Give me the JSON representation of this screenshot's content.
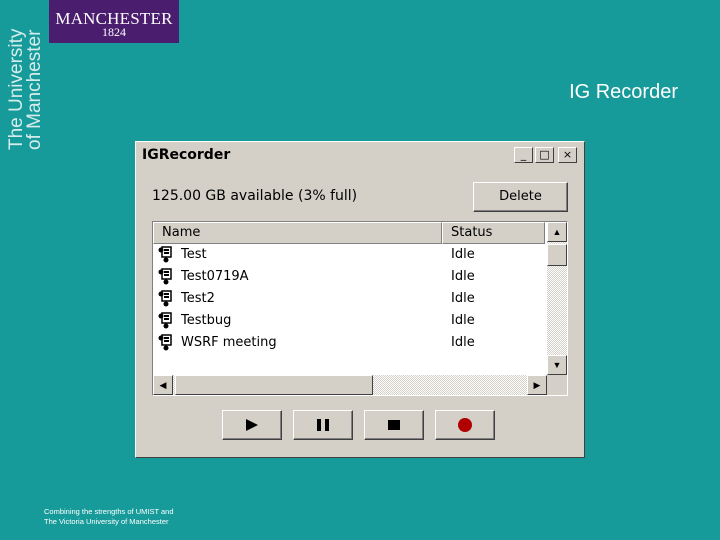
{
  "branding": {
    "logo_word": "MANCHESTER",
    "logo_year": "1824",
    "vertical_line1": "The University",
    "vertical_line2": "of Manchester",
    "colors": {
      "logo_bg": "#4b1d6e",
      "slide_bg": "#179b9a"
    }
  },
  "slide": {
    "title": "IG Recorder",
    "footer_line1": "Combining the strengths of UMIST and",
    "footer_line2": "The Victoria University of Manchester"
  },
  "window": {
    "title": "IGRecorder",
    "controls": {
      "minimize": "_",
      "maximize": "□",
      "close": "×"
    },
    "storage_text": "125.00 GB  available (3% full)",
    "delete_label": "Delete",
    "columns": {
      "name": "Name",
      "status": "Status"
    },
    "recordings": [
      {
        "name": "Test",
        "status": "Idle",
        "icon": "recording-icon"
      },
      {
        "name": "Test0719A",
        "status": "Idle",
        "icon": "recording-icon"
      },
      {
        "name": "Test2",
        "status": "Idle",
        "icon": "recording-icon"
      },
      {
        "name": "Testbug",
        "status": "Idle",
        "icon": "recording-icon"
      },
      {
        "name": "WSRF meeting",
        "status": "Idle",
        "icon": "recording-icon"
      }
    ],
    "transport": [
      "play-icon",
      "pause-icon",
      "stop-icon",
      "record-icon"
    ],
    "colors": {
      "record": "#b00000",
      "window_face": "#d4d0c8"
    }
  }
}
